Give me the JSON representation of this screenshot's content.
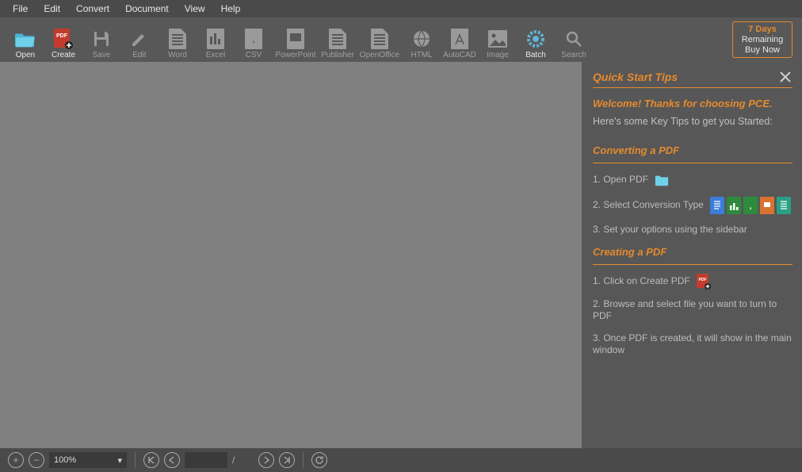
{
  "menu": [
    "File",
    "Edit",
    "Convert",
    "Document",
    "View",
    "Help"
  ],
  "toolbar": {
    "items": [
      {
        "id": "open",
        "label": "Open",
        "enabled": true
      },
      {
        "id": "create",
        "label": "Create",
        "enabled": true
      },
      {
        "id": "save",
        "label": "Save",
        "enabled": false
      },
      {
        "id": "edit",
        "label": "Edit",
        "enabled": false
      },
      {
        "id": "word",
        "label": "Word",
        "enabled": false
      },
      {
        "id": "excel",
        "label": "Excel",
        "enabled": false
      },
      {
        "id": "csv",
        "label": "CSV",
        "enabled": false
      },
      {
        "id": "powerpoint",
        "label": "PowerPoint",
        "enabled": false
      },
      {
        "id": "publisher",
        "label": "Publisher",
        "enabled": false
      },
      {
        "id": "openoffice",
        "label": "OpenOffice",
        "enabled": false
      },
      {
        "id": "html",
        "label": "HTML",
        "enabled": false
      },
      {
        "id": "autocad",
        "label": "AutoCAD",
        "enabled": false
      },
      {
        "id": "image",
        "label": "Image",
        "enabled": false
      },
      {
        "id": "batch",
        "label": "Batch",
        "enabled": true
      },
      {
        "id": "search",
        "label": "Search",
        "enabled": false
      }
    ]
  },
  "trial": {
    "days": "7 Days",
    "remaining": "Remaining",
    "buy": "Buy Now"
  },
  "tips": {
    "title": "Quick Start Tips",
    "welcome": "Welcome! Thanks for choosing PCE.",
    "subtitle": "Here's some Key Tips to get you Started:",
    "convert": {
      "heading": "Converting a PDF",
      "step1": "1. Open PDF",
      "step2": "2. Select Conversion Type",
      "step3": "3. Set your options using the sidebar"
    },
    "create": {
      "heading": "Creating a PDF",
      "step1": "1. Click on Create PDF",
      "step2": "2. Browse and select file you want to turn to PDF",
      "step3": "3. Once PDF is created, it will show in the main window"
    }
  },
  "status": {
    "zoom": "100%"
  }
}
